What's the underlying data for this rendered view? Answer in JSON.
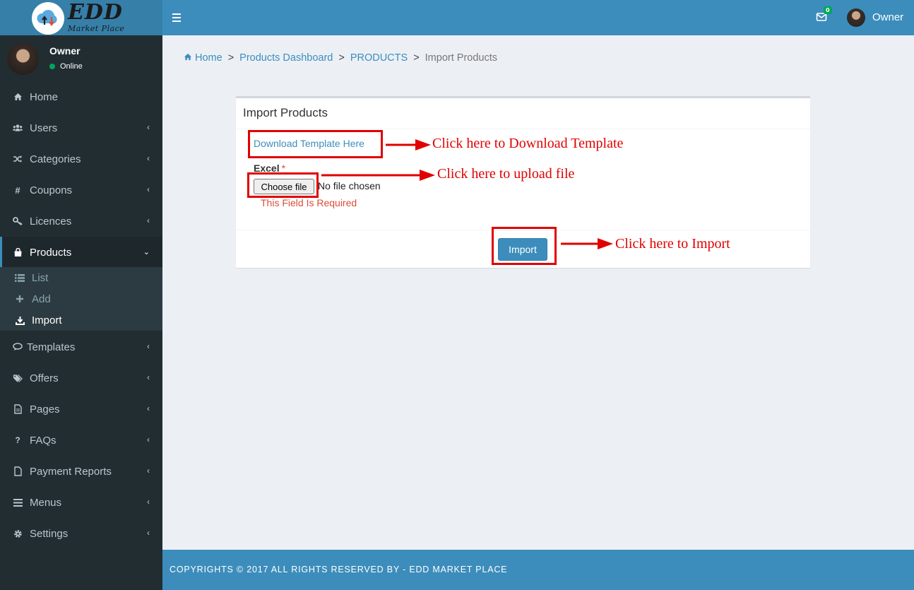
{
  "brand": {
    "logo_title": "EDD",
    "logo_subtitle": "Market Place"
  },
  "header": {
    "mail_badge": "0",
    "user_name": "Owner"
  },
  "sidebar": {
    "user": {
      "name": "Owner",
      "status": "Online"
    },
    "items": [
      {
        "label": "Home",
        "icon": "home-icon",
        "has_chevron": false
      },
      {
        "label": "Users",
        "icon": "users-icon",
        "has_chevron": true
      },
      {
        "label": "Categories",
        "icon": "shuffle-icon",
        "has_chevron": true
      },
      {
        "label": "Coupons",
        "icon": "hash-icon",
        "has_chevron": true
      },
      {
        "label": "Licences",
        "icon": "key-icon",
        "has_chevron": true
      },
      {
        "label": "Products",
        "icon": "shopping-bag-icon",
        "has_chevron": true,
        "active": true
      },
      {
        "label": "Templates",
        "icon": "comment-icon",
        "has_chevron": true
      },
      {
        "label": "Offers",
        "icon": "tags-icon",
        "has_chevron": true
      },
      {
        "label": "Pages",
        "icon": "file-icon",
        "has_chevron": true
      },
      {
        "label": "FAQs",
        "icon": "question-icon",
        "has_chevron": true
      },
      {
        "label": "Payment Reports",
        "icon": "file-icon",
        "has_chevron": true
      },
      {
        "label": "Menus",
        "icon": "bars-icon",
        "has_chevron": true
      },
      {
        "label": "Settings",
        "icon": "gear-icon",
        "has_chevron": true
      }
    ],
    "submenu": [
      {
        "label": "List",
        "icon": "list-icon"
      },
      {
        "label": "Add",
        "icon": "plus-icon"
      },
      {
        "label": "Import",
        "icon": "download-icon",
        "active": true
      }
    ]
  },
  "breadcrumb": {
    "home": "Home",
    "items": [
      "Products Dashboard",
      "PRODUCTS"
    ],
    "current": "Import Products",
    "separator": ">"
  },
  "form": {
    "title": "Import Products",
    "download_link": "Download Template Here",
    "excel_label": "Excel",
    "required_mark": "*",
    "file_button": "Choose file",
    "file_status": "No file chosen",
    "error": "This Field Is Required",
    "import_button": "Import"
  },
  "annotations": {
    "download": "Click here to Download Template",
    "upload": "Click here to upload file",
    "import": "Click here to Import",
    "color": "#e00000"
  },
  "footer": {
    "text": "COPYRIGHTS © 2017 ALL RIGHTS RESERVED BY - EDD MARKET PLACE"
  },
  "colors": {
    "header": "#3c8dbc",
    "logo_bg": "#367fa9",
    "sidebar": "#222d32",
    "sidebar_active": "#1e282c",
    "submenu": "#2c3b41",
    "link": "#3c8dbc",
    "error": "#dd4b39",
    "body_bg": "#ecf0f5"
  }
}
